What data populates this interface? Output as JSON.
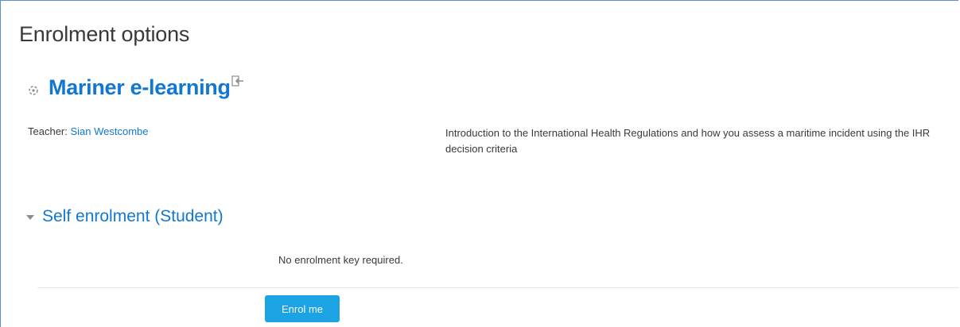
{
  "page": {
    "title": "Enrolment options"
  },
  "course": {
    "name": "Mariner e-learning",
    "teacher_label": "Teacher: ",
    "teacher_name": "Sian Westcombe",
    "summary": "Introduction to the International Health Regulations and how you assess a maritime incident using the IHR decision criteria",
    "icon": "course-icon",
    "enter_icon": "enter-course-icon"
  },
  "enrolment": {
    "section_title": "Self enrolment (Student)",
    "no_key_text": "No enrolment key required.",
    "button_label": "Enrol me"
  },
  "colors": {
    "link": "#1177d1",
    "button": "#1ca3e3",
    "text": "#373a3c"
  }
}
